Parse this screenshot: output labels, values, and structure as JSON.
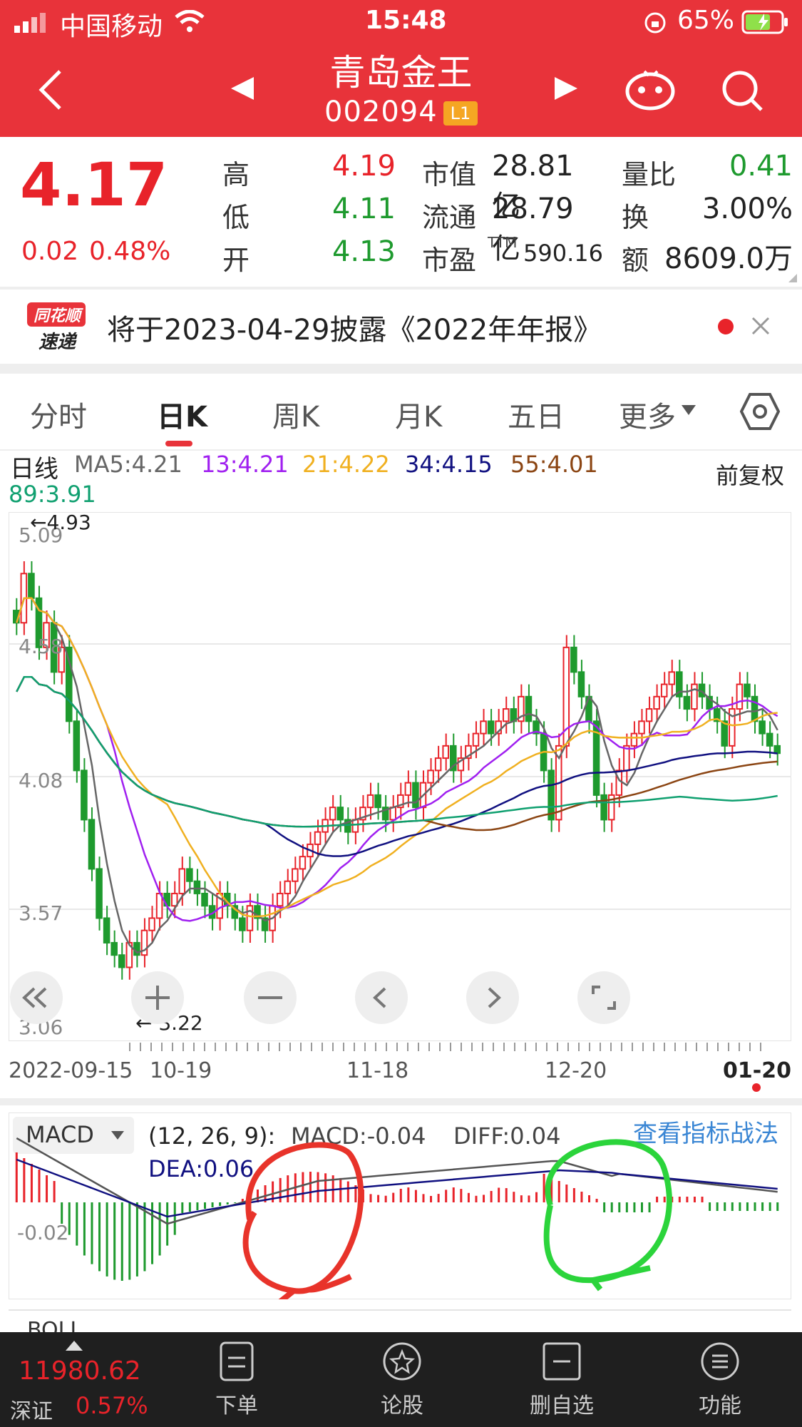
{
  "status_bar": {
    "carrier": "中国移动",
    "time": "15:48",
    "battery": "65%"
  },
  "nav": {
    "title": "青岛金王",
    "code": "002094",
    "badge": "L1"
  },
  "quote": {
    "price": "4.17",
    "change": "0.02",
    "change_pct": "0.48%",
    "high_label": "高",
    "high": "4.19",
    "low_label": "低",
    "low": "4.11",
    "open_label": "开",
    "open": "4.13",
    "mcap_label": "市值",
    "mcap": "28.81亿",
    "float_label": "流通",
    "float": "28.79亿",
    "pe_label": "市盈",
    "pe_sup": "TTM",
    "pe": "590.16",
    "vol_ratio_label": "量比",
    "vol_ratio": "0.41",
    "turnover_label": "换",
    "turnover": "3.00%",
    "amount_label": "额",
    "amount": "8609.0万"
  },
  "notice": {
    "logo_top": "同花顺",
    "logo_bottom": "速递",
    "text": "将于2023-04-29披露《2022年年报》"
  },
  "tabs": [
    {
      "label": "分时"
    },
    {
      "label": "日K"
    },
    {
      "label": "周K"
    },
    {
      "label": "月K"
    },
    {
      "label": "五日"
    },
    {
      "label": "更多"
    }
  ],
  "ma": {
    "line_label": "日线",
    "ma5": "MA5:4.21",
    "ma13": "13:4.21",
    "ma21": "21:4.22",
    "ma34": "34:4.15",
    "ma55": "55:4.01",
    "ma89": "89:3.91",
    "adjust": "前复权"
  },
  "colors": {
    "header": "#e8333a",
    "up": "#e8232a",
    "down": "#1e9a2e",
    "ma5": "#666666",
    "ma13": "#a020f0",
    "ma21": "#f0b020",
    "ma34": "#101080",
    "ma55": "#8b4513",
    "ma89": "#10a070"
  },
  "chart": {
    "y_ticks": [
      "5.09",
      "4.58",
      "4.08",
      "3.57",
      "3.06"
    ],
    "high_marker": "←4.93",
    "low_marker": "← 3.22",
    "dates": [
      "2022-09-15",
      "10-19",
      "11-18",
      "12-20",
      "01-20"
    ]
  },
  "macd": {
    "label": "MACD",
    "params": "(12, 26, 9):",
    "macd": "MACD:-0.04",
    "diff": "DIFF:0.04",
    "dea": "DEA:0.06",
    "link": "查看指标战法",
    "y_tick": "-0.02"
  },
  "boll": {
    "label": "BOLL"
  },
  "bottom_bar": {
    "index_value": "11980.62",
    "index_name": "深证",
    "index_pct": "0.57%",
    "order": "下单",
    "discuss": "论股",
    "remove_watch": "删自选",
    "function": "功能"
  }
}
